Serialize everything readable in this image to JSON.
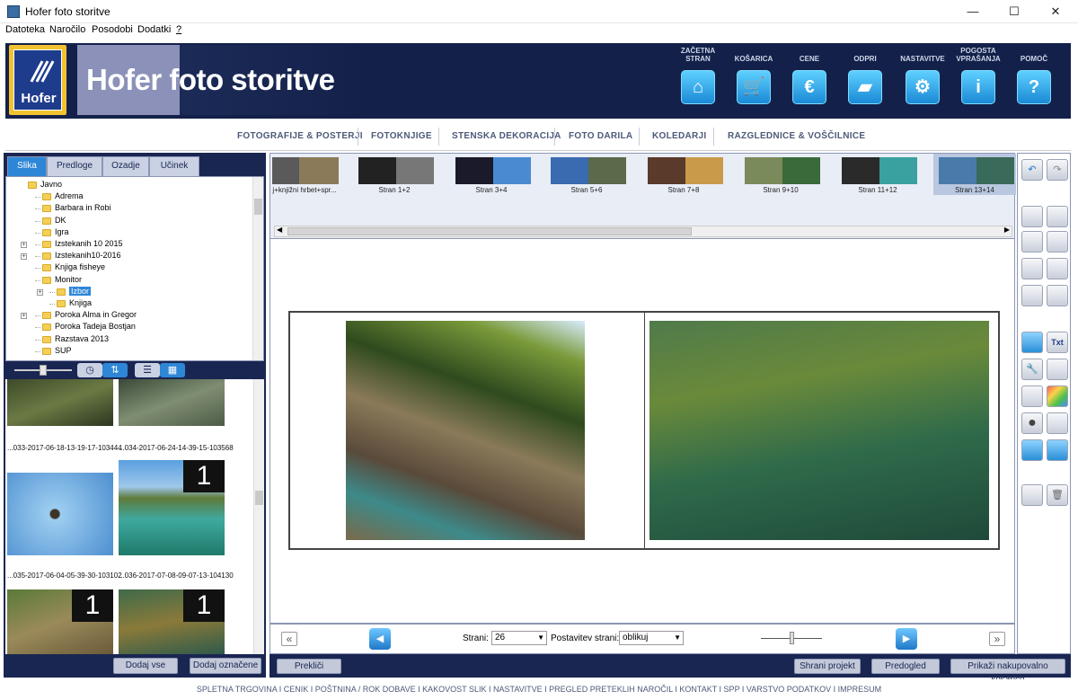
{
  "window": {
    "title": "Hofer foto storitve",
    "controls": [
      "—",
      "☐",
      "✕"
    ]
  },
  "menu": [
    "Datoteka",
    "Naročilo",
    "Posodobi",
    "Dodatki",
    "?"
  ],
  "logo": {
    "text": "Hofer"
  },
  "banner": {
    "title": "Hofer foto storitve"
  },
  "header_nav": [
    {
      "label": "ZAČETNA STRAN",
      "icon": "home-icon",
      "glyph": "⌂"
    },
    {
      "label": "KOŠARICA",
      "icon": "cart-icon",
      "glyph": "🛒"
    },
    {
      "label": "CENE",
      "icon": "euro-icon",
      "glyph": "€"
    },
    {
      "label": "ODPRI",
      "icon": "folder-icon",
      "glyph": "▰"
    },
    {
      "label": "NASTAVITVE",
      "icon": "gears-icon",
      "glyph": "⚙"
    },
    {
      "label": "POGOSTA VPRAŠANJA",
      "icon": "info-icon",
      "glyph": "i"
    },
    {
      "label": "POMOČ",
      "icon": "help-icon",
      "glyph": "?"
    }
  ],
  "categories": [
    "FOTOGRAFIJE & POSTERJI",
    "FOTOKNJIGE",
    "STENSKA DEKORACIJA",
    "FOTO DARILA",
    "KOLEDARJI",
    "RAZGLEDNICE & VOŠČILNICE"
  ],
  "tabs": [
    "Slika",
    "Predloge",
    "Ozadje",
    "Učinek"
  ],
  "tree": [
    {
      "label": "Javno",
      "level": 0
    },
    {
      "label": "Adrema",
      "level": 1
    },
    {
      "label": "Barbara in Robi",
      "level": 1
    },
    {
      "label": "DK",
      "level": 1
    },
    {
      "label": "Igra",
      "level": 1
    },
    {
      "label": "Izstekanih 10 2015",
      "level": 1,
      "expander": "+"
    },
    {
      "label": "Izstekanih10-2016",
      "level": 1,
      "expander": "+"
    },
    {
      "label": "Knjiga fisheye",
      "level": 1
    },
    {
      "label": "Monitor",
      "level": 1
    },
    {
      "label": "Izbor",
      "level": 2,
      "selected": true,
      "expander": "+"
    },
    {
      "label": "Knjiga",
      "level": 2
    },
    {
      "label": "Poroka Alma in Gregor",
      "level": 1,
      "expander": "+"
    },
    {
      "label": "Poroka Tadeja Bostjan",
      "level": 1
    },
    {
      "label": "Razstava 2013",
      "level": 1
    },
    {
      "label": "SUP",
      "level": 1
    }
  ],
  "thumbs": [
    {
      "caption": "...033-2017-06-18-13-19-17-103444",
      "badge": ""
    },
    {
      "caption": "...034-2017-06-24-14-39-15-103568",
      "badge": ""
    },
    {
      "caption": "...035-2017-06-04-05-39-30-103102",
      "badge": ""
    },
    {
      "caption": "...036-2017-07-08-09-07-13-104130",
      "badge": "1"
    },
    {
      "caption": "",
      "badge": "1"
    },
    {
      "caption": "",
      "badge": "1"
    }
  ],
  "left_buttons": {
    "add_all": "Dodaj vse",
    "add_selected": "Dodaj označene"
  },
  "pages": [
    "j+knjižni hrbet+spr...",
    "Stran 1+2",
    "Stran 3+4",
    "Stran 5+6",
    "Stran 7+8",
    "Stran 9+10",
    "Stran 11+12",
    "Stran 13+14"
  ],
  "bottom": {
    "pages_label": "Strani:",
    "pages_value": "26",
    "layout_label": "Postavitev strani:",
    "layout_value": "oblikuj",
    "prev": "«",
    "next": "»"
  },
  "actions": {
    "cancel": "Prekliči",
    "save": "Shrani projekt",
    "preview": "Predogled",
    "cart": "Prikaži nakupovalno košarico"
  },
  "footer": "SPLETNA TRGOVINA I CENIK I POŠTNINA / ROK DOBAVE I KAKOVOST SLIK I NASTAVITVE I PREGLED PRETEKLIH NAROČIL I KONTAKT I SPP I VARSTVO PODATKOV I IMPRESUM",
  "colors": {
    "navy": "#13214a",
    "accent": "#2e86d6",
    "panel": "#1a2652"
  }
}
